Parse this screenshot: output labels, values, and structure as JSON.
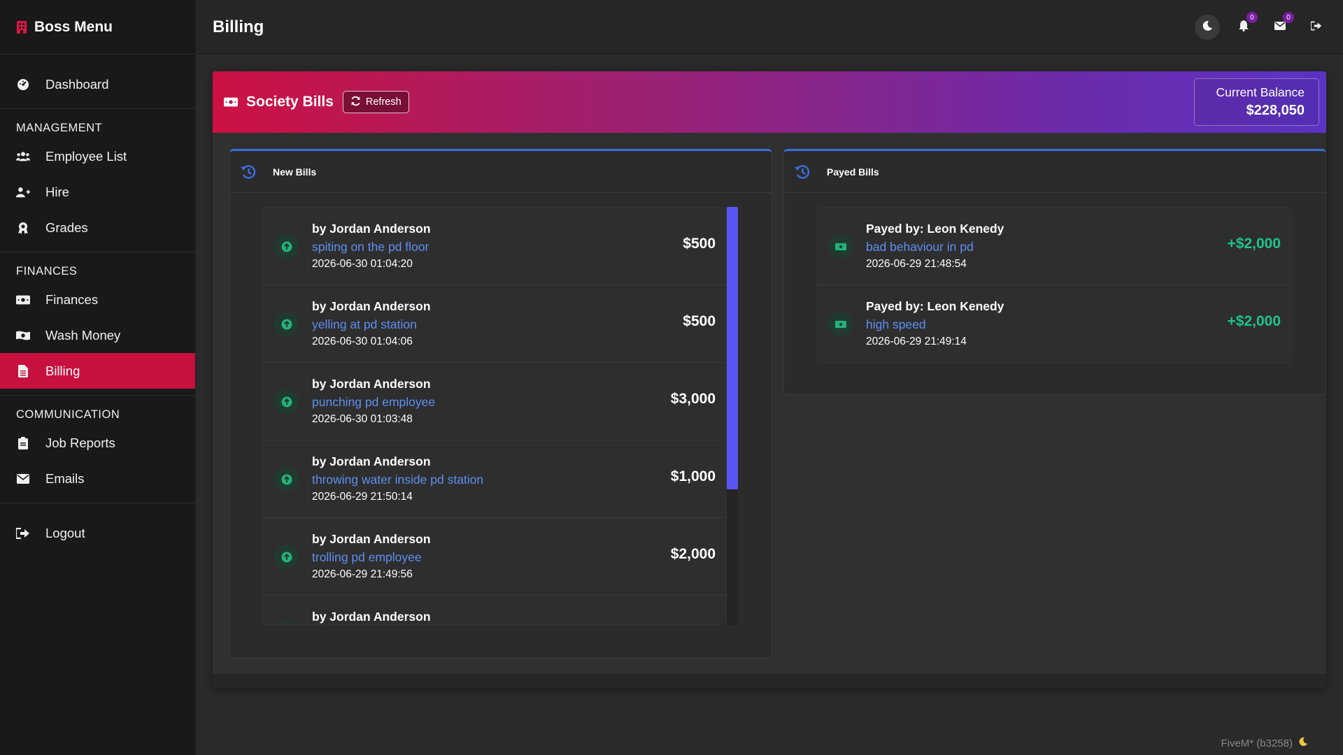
{
  "sidebar": {
    "brand": "Boss Menu",
    "dashboard": "Dashboard",
    "sections": {
      "management": "MANAGEMENT",
      "finances": "FINANCES",
      "communication": "COMMUNICATION"
    },
    "items": {
      "employee_list": "Employee List",
      "hire": "Hire",
      "grades": "Grades",
      "finances": "Finances",
      "wash_money": "Wash Money",
      "billing": "Billing",
      "job_reports": "Job Reports",
      "emails": "Emails",
      "logout": "Logout"
    },
    "active": "billing",
    "accent_color": "#c8103e"
  },
  "header": {
    "title": "Billing",
    "notifications_count": "0",
    "messages_count": "0"
  },
  "society": {
    "title": "Society Bills",
    "refresh_label": "Refresh",
    "balance_label": "Current Balance",
    "balance_value": "$228,050"
  },
  "new_bills": {
    "title": "New Bills",
    "items": [
      {
        "who": "by Jordan Anderson",
        "reason": "spiting on the pd floor",
        "when": "2026-06-30 01:04:20",
        "amount": "$500"
      },
      {
        "who": "by Jordan Anderson",
        "reason": "yelling at pd station",
        "when": "2026-06-30 01:04:06",
        "amount": "$500"
      },
      {
        "who": "by Jordan Anderson",
        "reason": "punching pd employee",
        "when": "2026-06-30 01:03:48",
        "amount": "$3,000"
      },
      {
        "who": "by Jordan Anderson",
        "reason": "throwing water inside pd station",
        "when": "2026-06-29 21:50:14",
        "amount": "$1,000"
      },
      {
        "who": "by Jordan Anderson",
        "reason": "trolling pd employee",
        "when": "2026-06-29 21:49:56",
        "amount": "$2,000"
      },
      {
        "who": "by Jordan Anderson",
        "reason": "",
        "when": "",
        "amount": ""
      }
    ]
  },
  "payed_bills": {
    "title": "Payed Bills",
    "items": [
      {
        "who": "Payed by: Leon Kenedy",
        "reason": "bad behaviour in pd",
        "when": "2026-06-29 21:48:54",
        "amount": "+$2,000"
      },
      {
        "who": "Payed by: Leon Kenedy",
        "reason": "high speed",
        "when": "2026-06-29 21:49:14",
        "amount": "+$2,000"
      }
    ]
  },
  "footer": {
    "build": "FiveM* (b3258)"
  }
}
